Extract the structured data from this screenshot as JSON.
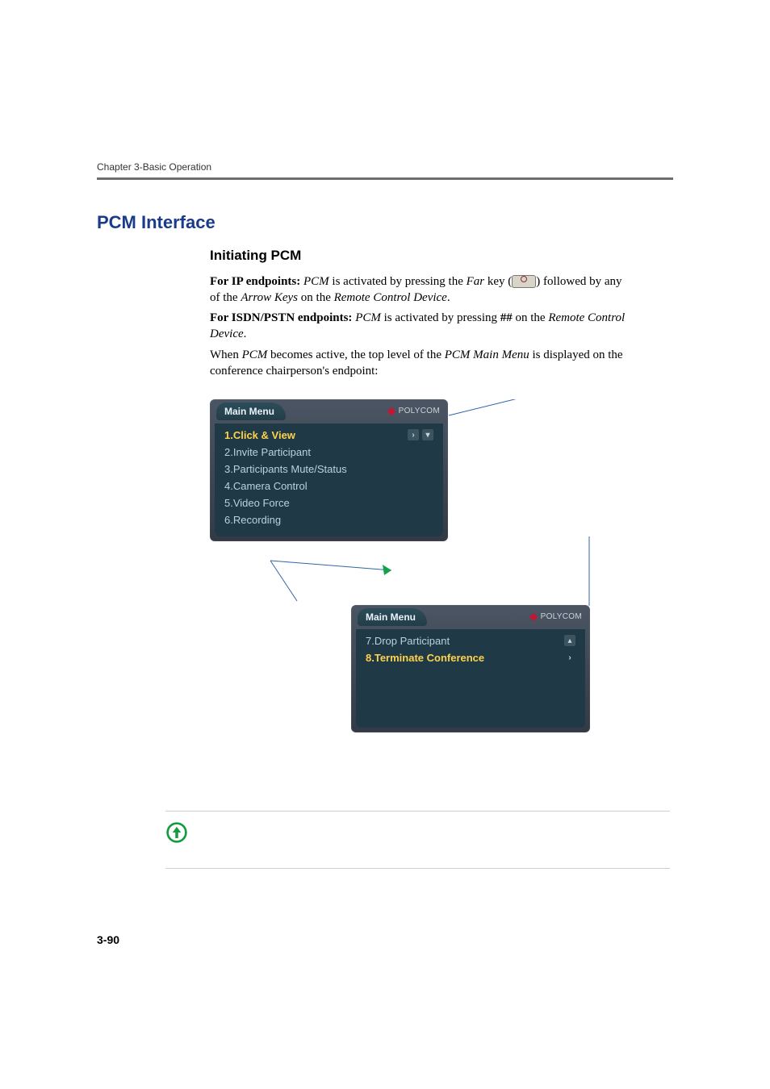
{
  "header": {
    "chapter": "Chapter 3-Basic Operation"
  },
  "section": {
    "title": "PCM Interface"
  },
  "subhead": {
    "title": "Initiating PCM"
  },
  "para1": {
    "lead": "For IP endpoints: ",
    "t1": "PCM",
    "t2": " is activated by pressing the ",
    "t3": "Far",
    "t4": " key (",
    "t5": ") followed by any of the ",
    "t6": "Arrow Keys",
    "t7": " on the ",
    "t8": "Remote Control Device",
    "t9": "."
  },
  "para2": {
    "lead": "For ISDN/PSTN endpoints: ",
    "t1": "PCM",
    "t2": " is activated by pressing ",
    "hash": "##",
    "t3": " on the ",
    "t4": "Remote Control Device",
    "t5": "."
  },
  "para3": {
    "t1": "When ",
    "t2": "PCM",
    "t3": " becomes active, the top level of the ",
    "t4": "PCM Main Menu",
    "t5": " is displayed on the conference chairperson's endpoint:"
  },
  "panel1": {
    "title": "Main Menu",
    "brand": "POLYCOM",
    "items": [
      "1.Click & View",
      "2.Invite Participant",
      "3.Participants Mute/Status",
      "4.Camera Control",
      "5.Video Force",
      "6.Recording"
    ]
  },
  "panel2": {
    "title": "Main Menu",
    "brand": "POLYCOM",
    "items": [
      "7.Drop Participant",
      "8.Terminate Conference"
    ]
  },
  "footer": {
    "page": "3-90"
  }
}
